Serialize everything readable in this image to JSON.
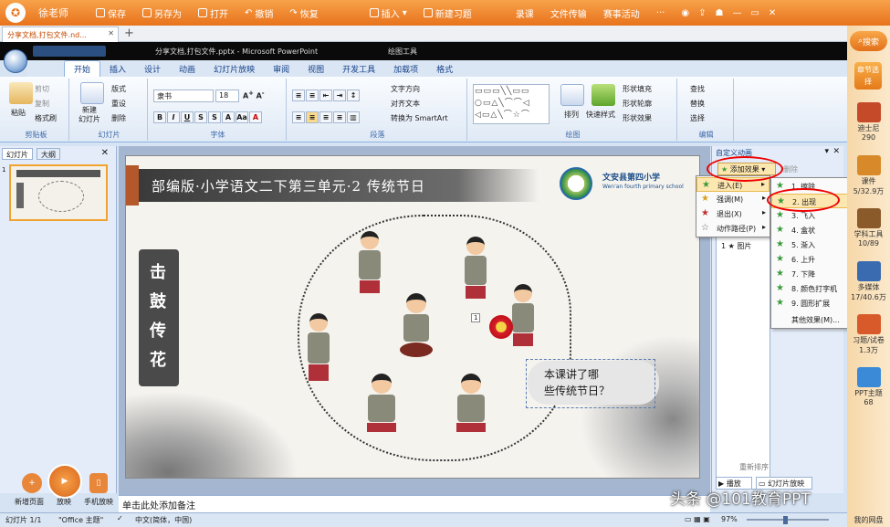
{
  "topbar": {
    "user": "徐老师",
    "save": "保存",
    "save_as": "另存为",
    "open": "打开",
    "undo": "撤销",
    "redo": "恢复",
    "insert": "插入",
    "new_exercise": "新建习题",
    "record": "录课",
    "file_transfer": "文件传输",
    "contest": "赛事活动",
    "more": "···"
  },
  "doc_tab": {
    "label": "分享文档,打包文件.nd...",
    "close": "✕",
    "add": "+"
  },
  "ppt_title": {
    "title": "分享文档,打包文件.pptx - Microsoft PowerPoint",
    "context_tool": "绘图工具"
  },
  "ribbon_tabs": [
    "开始",
    "插入",
    "设计",
    "动画",
    "幻灯片放映",
    "审阅",
    "视图",
    "开发工具",
    "加载项",
    "格式"
  ],
  "clipboard": {
    "paste": "粘贴",
    "cut": "剪切",
    "copy": "复制",
    "format_painter": "格式刷",
    "label": "剪贴板"
  },
  "slides_group": {
    "new_slide": "新建\n幻灯片",
    "layout": "版式",
    "reset": "重设",
    "delete": "删除",
    "label": "幻灯片"
  },
  "font_group": {
    "font": "隶书",
    "size": "18",
    "label": "字体"
  },
  "para_group": {
    "text_direction": "文字方向",
    "align_text": "对齐文本",
    "smartart": "转换为 SmartArt",
    "label": "段落"
  },
  "drawing_group": {
    "arrange": "排列",
    "quick_styles": "快速样式",
    "fill": "形状填充",
    "outline": "形状轮廓",
    "effects": "形状效果",
    "label": "绘图"
  },
  "editing_group": {
    "find": "查找",
    "replace": "替换",
    "select": "选择",
    "label": "编辑"
  },
  "left_panel": {
    "tab_slides": "幻灯片",
    "tab_outline": "大纲",
    "slide_num": "1"
  },
  "slide": {
    "banner": "部编版·小学语文二下第三单元·2 传统节日",
    "school_cn": "文安县第四小学",
    "school_en": "Wen'an fourth primary school",
    "vertical_title": "击鼓传花",
    "anim_tag": "1",
    "question_line1": "本课讲了哪",
    "question_line2": "些传统节日？"
  },
  "right_pane": {
    "title": "自定义动画",
    "add_effect": "添加效果",
    "remove": "删除",
    "list_item": "1 ★ 图片",
    "reorder": "重新排序",
    "play": "播放",
    "slideshow": "幻灯片放映"
  },
  "effect_menu": [
    {
      "label": "进入(E)",
      "icon": "enter-star"
    },
    {
      "label": "强调(M)",
      "icon": "emphasis-star"
    },
    {
      "label": "退出(X)",
      "icon": "exit-star"
    },
    {
      "label": "动作路径(P)",
      "icon": "path-star"
    }
  ],
  "entrance_menu": [
    "1. 擦除",
    "2. 出现",
    "3. 飞入",
    "4. 盒状",
    "5. 渐入",
    "6. 上升",
    "7. 下降",
    "8. 颜色打字机",
    "9. 圆形扩展",
    "其他效果(M)..."
  ],
  "sidebar": {
    "search": "搜索",
    "chapter_select": "章节选择",
    "items": [
      {
        "label": "迪士尼",
        "count": "290"
      },
      {
        "label": "课件",
        "count": "5/32.9万"
      },
      {
        "label": "学科工具",
        "count": "10/89"
      },
      {
        "label": "多媒体",
        "count": "17/40.6万"
      },
      {
        "label": "习题/试卷",
        "count": "1.3万"
      },
      {
        "label": "PPT主题",
        "count": "68"
      }
    ],
    "my_site": "我的网盘"
  },
  "bottom_buttons": {
    "new_page": "新增页面",
    "play": "放映",
    "phone": "手机放映"
  },
  "notes_placeholder": "单击此处添加备注",
  "status": {
    "slide": "幻灯片 1/1",
    "theme": "\"Office 主题\"",
    "lang": "中文(简体，中国)",
    "zoom": "97%"
  },
  "watermark": "头条 @101教育PPT"
}
